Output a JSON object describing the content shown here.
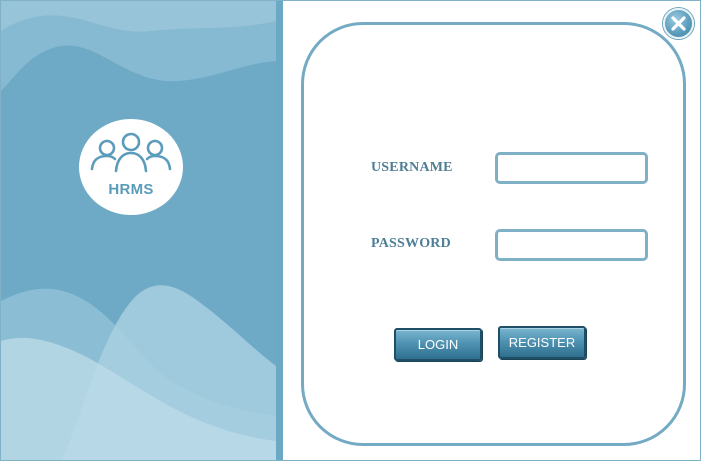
{
  "logo": {
    "text": "HRMS",
    "icon": "people-group-icon"
  },
  "close_button": {
    "icon": "close-icon"
  },
  "form": {
    "username_label": "USERNAME",
    "username_value": "",
    "password_label": "PASSWORD",
    "password_value": ""
  },
  "buttons": {
    "login_label": "LOGIN",
    "register_label": "REGISTER"
  },
  "colors": {
    "panel": "#6eaac6",
    "accent": "#74aac4",
    "label": "#4e7e96",
    "button": "#4f93b2"
  }
}
